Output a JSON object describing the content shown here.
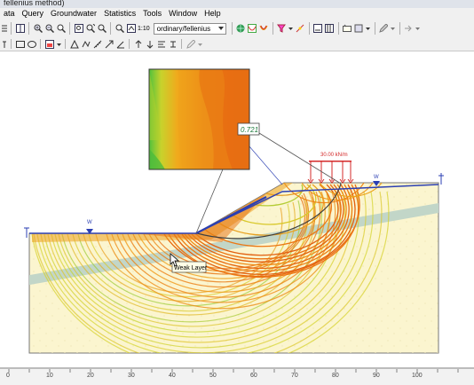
{
  "window": {
    "title": "fellenius method)"
  },
  "menu": [
    "ata",
    "Query",
    "Groundwater",
    "Statistics",
    "Tools",
    "Window",
    "Help"
  ],
  "toolbar": {
    "scale_label": "1:10",
    "method_select": "ordinary/fellenius"
  },
  "model": {
    "factor_of_safety": "0.721",
    "load_label": "30.00 kN/m",
    "weak_layer_label": "Weak Layer",
    "water_marker": "W"
  },
  "ruler": {
    "labels": [
      "0",
      "10",
      "20",
      "30",
      "40",
      "50",
      "60",
      "70",
      "80",
      "90",
      "100"
    ]
  },
  "colors": {
    "soil": "#fbf5cf",
    "weak_layer": "#c2d6c8",
    "water_table": "#2b3fb3",
    "load": "#d42a2a",
    "slip_hot": "#e87410",
    "slip_cool": "#d6d22a"
  }
}
